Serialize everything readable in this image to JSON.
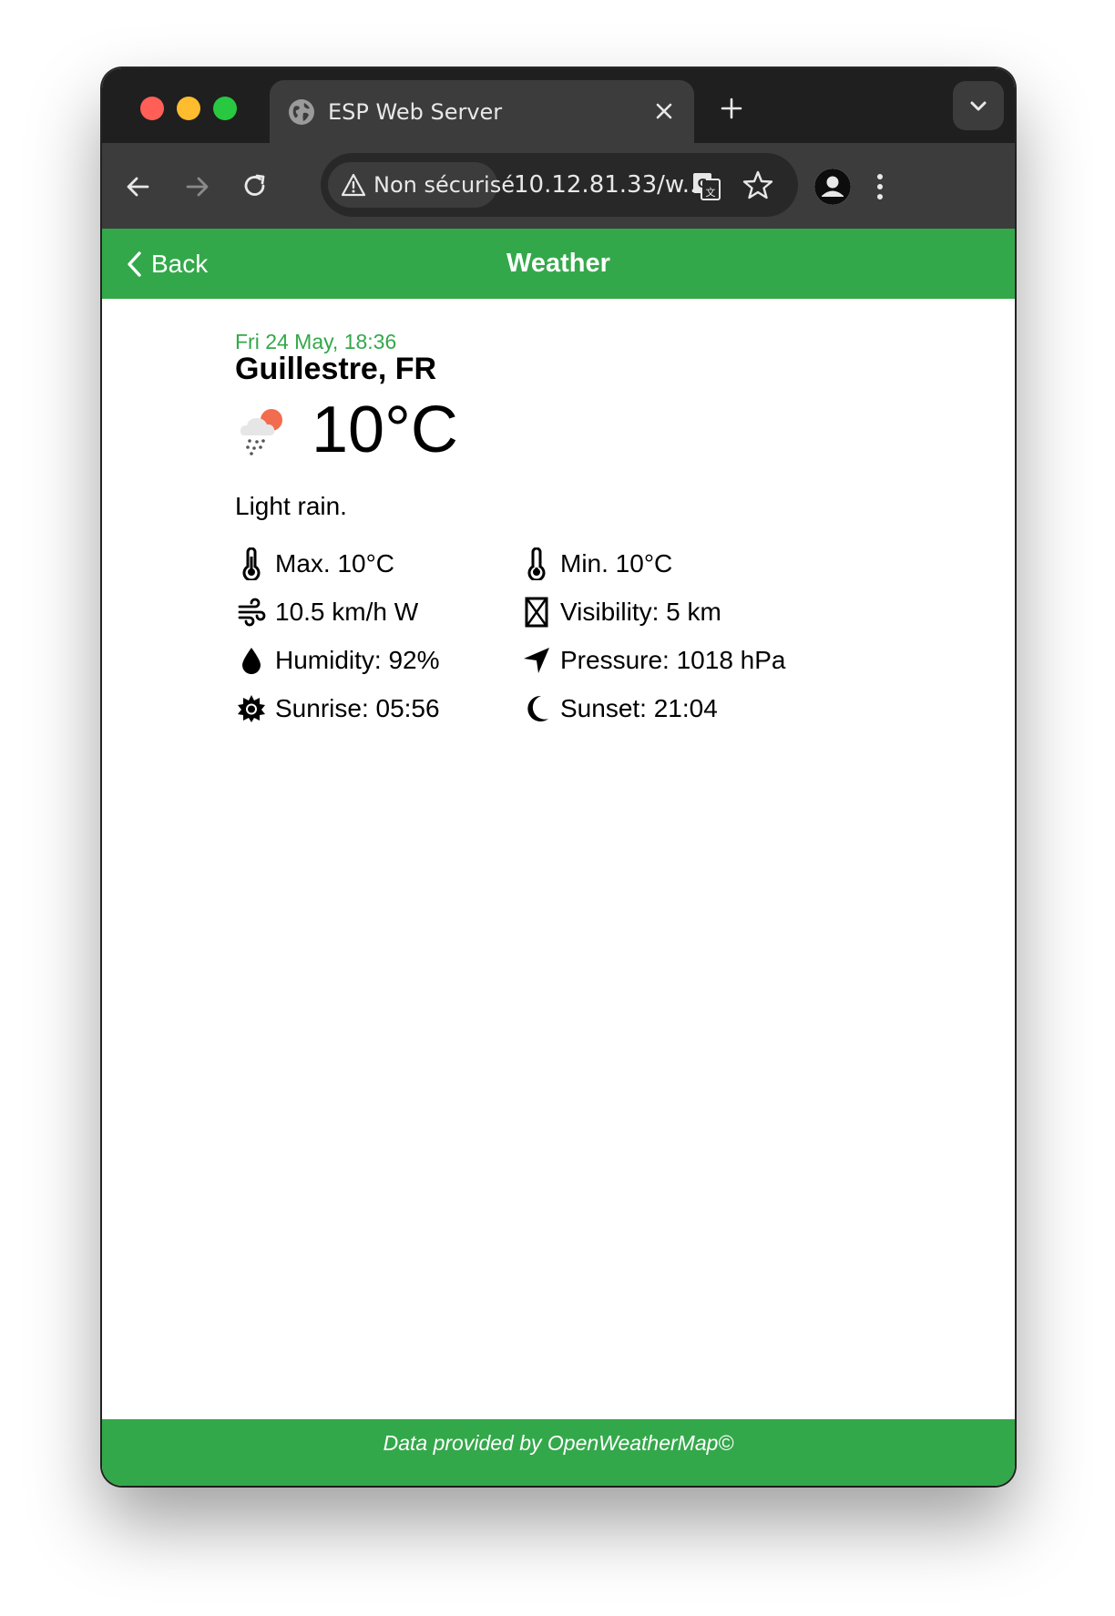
{
  "browser": {
    "tab_title": "ESP Web Server",
    "security_label": "Non sécurisé",
    "url": "10.12.81.33/w..."
  },
  "header": {
    "back_label": "Back",
    "title": "Weather"
  },
  "weather": {
    "datetime": "Fri 24 May, 18:36",
    "location": "Guillestre, FR",
    "temperature": "10°C",
    "condition_icon": "rain-cloud-sun-icon",
    "description": "Light rain."
  },
  "stats": [
    {
      "icon": "thermometer-icon",
      "text": "Max. 10°C"
    },
    {
      "icon": "thermometer-icon",
      "text": "Min. 10°C"
    },
    {
      "icon": "wind-icon",
      "text": "10.5 km/h W"
    },
    {
      "icon": "visibility-icon",
      "text": "Visibility: 5 km"
    },
    {
      "icon": "droplet-icon",
      "text": "Humidity: 92%"
    },
    {
      "icon": "location-arrow-icon",
      "text": "Pressure: 1018 hPa"
    },
    {
      "icon": "sun-icon",
      "text": "Sunrise: 05:56"
    },
    {
      "icon": "moon-icon",
      "text": "Sunset: 21:04"
    }
  ],
  "footer": {
    "text": "Data provided by OpenWeatherMap©"
  },
  "colors": {
    "accent": "#33a84a",
    "browser_dark": "#1f1f1f",
    "browser_toolbar": "#3c3c3c"
  }
}
